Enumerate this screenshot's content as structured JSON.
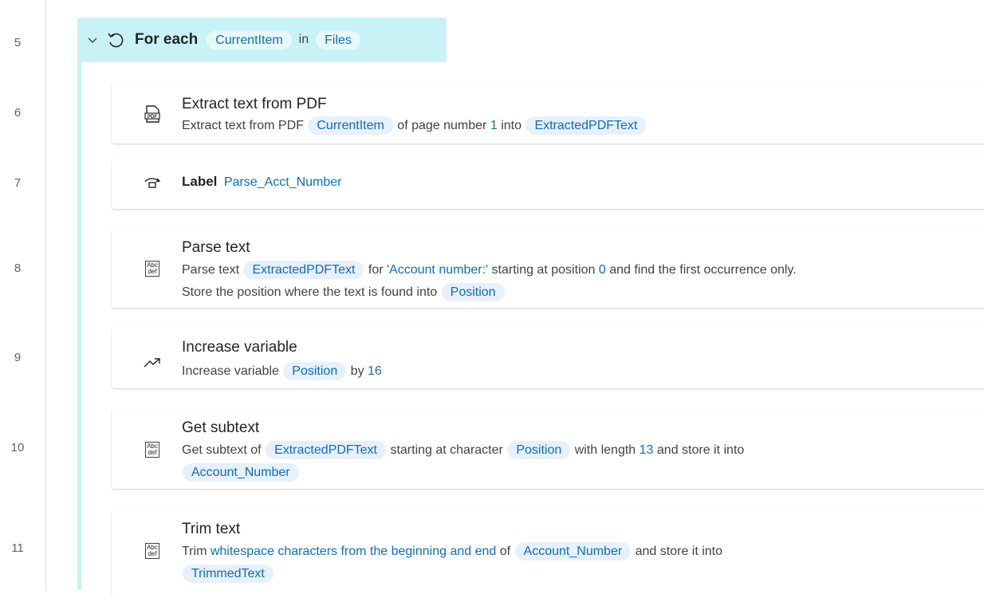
{
  "line_numbers": [
    "5",
    "6",
    "7",
    "8",
    "9",
    "10",
    "11"
  ],
  "foreach": {
    "title": "For each",
    "item_var": "CurrentItem",
    "in_kw": "in",
    "collection_var": "Files"
  },
  "actions": {
    "extract": {
      "title": "Extract text from PDF",
      "d1": "Extract text from PDF",
      "var1": "CurrentItem",
      "d2": "of page number",
      "page": "1",
      "d3": "into",
      "var2": "ExtractedPDFText"
    },
    "label": {
      "keyword": "Label",
      "name": "Parse_Acct_Number"
    },
    "parse": {
      "title": "Parse text",
      "d1": "Parse text",
      "var1": "ExtractedPDFText",
      "d2": "for",
      "literal": "'Account number:'",
      "d3": "starting at position",
      "pos": "0",
      "d4": "and find the first occurrence only.",
      "d5": "Store the position where the text is found into",
      "var2": "Position"
    },
    "increase": {
      "title": "Increase variable",
      "d1": "Increase variable",
      "var1": "Position",
      "d2": "by",
      "amount": "16"
    },
    "subtext": {
      "title": "Get subtext",
      "d1": "Get subtext of",
      "var1": "ExtractedPDFText",
      "d2": "starting at character",
      "var2": "Position",
      "d3": "with length",
      "length": "13",
      "d4": "and store it into",
      "var3": "Account_Number"
    },
    "trim": {
      "title": "Trim text",
      "d1": "Trim",
      "mode": "whitespace characters from the beginning and end",
      "d2": "of",
      "var1": "Account_Number",
      "d3": "and store it into",
      "var2": "TrimmedText"
    }
  },
  "icons": {
    "expand": "chevron-down-icon",
    "loop": "loop-icon",
    "pdf": "pdf-icon",
    "label": "label-icon",
    "text": "text-abc-icon",
    "increase": "trend-up-icon"
  }
}
